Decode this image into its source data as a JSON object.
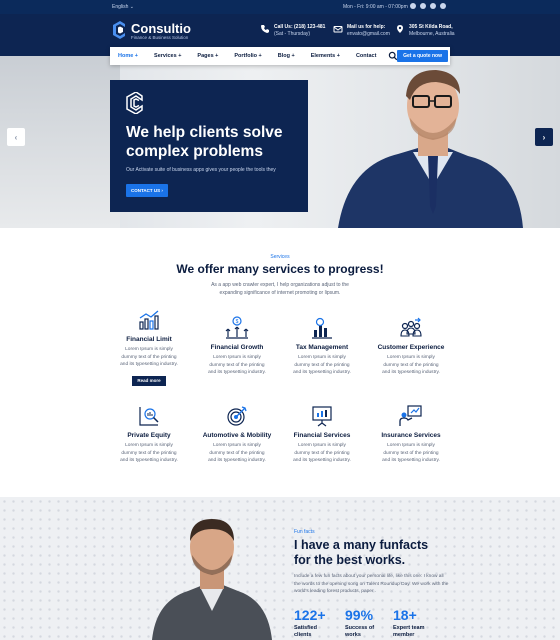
{
  "topbar": {
    "language": "English ⌄",
    "hours": "Mon - Fri: 9:00 am - 07:00pm"
  },
  "header": {
    "logo_name": "Consultio",
    "logo_tagline": "Finance & Business Solution",
    "phone": {
      "title": "Call Us: (218) 123-481",
      "sub": "(Sat - Thursday)"
    },
    "mail": {
      "title": "Mail us for help:",
      "sub": "envato@gmail.com"
    },
    "address": {
      "title": "305 St Kilda Road,",
      "sub": "Melbourne, Australia"
    }
  },
  "nav": {
    "items": [
      "Home",
      "Services",
      "Pages",
      "Portfolio",
      "Blog",
      "Elements",
      "Contact"
    ],
    "cta": "Get a quote now"
  },
  "hero": {
    "title": "We help clients solve complex problems",
    "subtitle": "Our Activate suite of business apps gives your people the tools they",
    "button": "CONTACT US"
  },
  "services": {
    "kicker": "Services",
    "title": "We offer many services to progress!",
    "description": "As a app web crawler expert, I help organizations adjust to the expanding significance of internet promoting or lipsum.",
    "items": [
      {
        "name": "Financial Limit",
        "icon": "bar-chart-rise-icon",
        "desc": "Lorem Ipsum is simply dummy text of the printing and its typesetting industry.",
        "button": "Read more"
      },
      {
        "name": "Financial Growth",
        "icon": "growth-coin-icon",
        "desc": "Lorem Ipsum is simply dummy text of the printing and its typesetting industry."
      },
      {
        "name": "Tax Management",
        "icon": "tax-chart-icon",
        "desc": "Lorem Ipsum is simply dummy text of the printing and its typesetting industry."
      },
      {
        "name": "Customer Experience",
        "icon": "team-icon",
        "desc": "Lorem Ipsum is simply dummy text of the printing and its typesetting industry."
      },
      {
        "name": "Private Equity",
        "icon": "magnifier-chart-icon",
        "desc": "Lorem Ipsum is simply dummy text of the printing and its typesetting industry."
      },
      {
        "name": "Automotive & Mobility",
        "icon": "target-icon",
        "desc": "Lorem Ipsum is simply dummy text of the printing and its typesetting industry."
      },
      {
        "name": "Financial Services",
        "icon": "presentation-board-icon",
        "desc": "Lorem Ipsum is simply dummy text of the printing and its typesetting industry."
      },
      {
        "name": "Insurance Services",
        "icon": "presenter-icon",
        "desc": "Lorem Ipsum is simply dummy text of the printing and its typesetting industry."
      }
    ]
  },
  "facts": {
    "kicker": "Fun facts",
    "title": "I have a many funfacts for the best works.",
    "description": "Include a few fun facts about your personal life, like this one: I know all the words to the opening song on Talent Roundup Day. We work with the world's leading forest products, paper .",
    "stats": [
      {
        "value": "122+",
        "label": "Satisfied clients"
      },
      {
        "value": "99%",
        "label": "Success of works"
      },
      {
        "value": "18+",
        "label": "Expert team member"
      }
    ]
  },
  "colors": {
    "navy": "#0d2552",
    "accent": "#1a73e8",
    "text": "#0b1c3f"
  }
}
